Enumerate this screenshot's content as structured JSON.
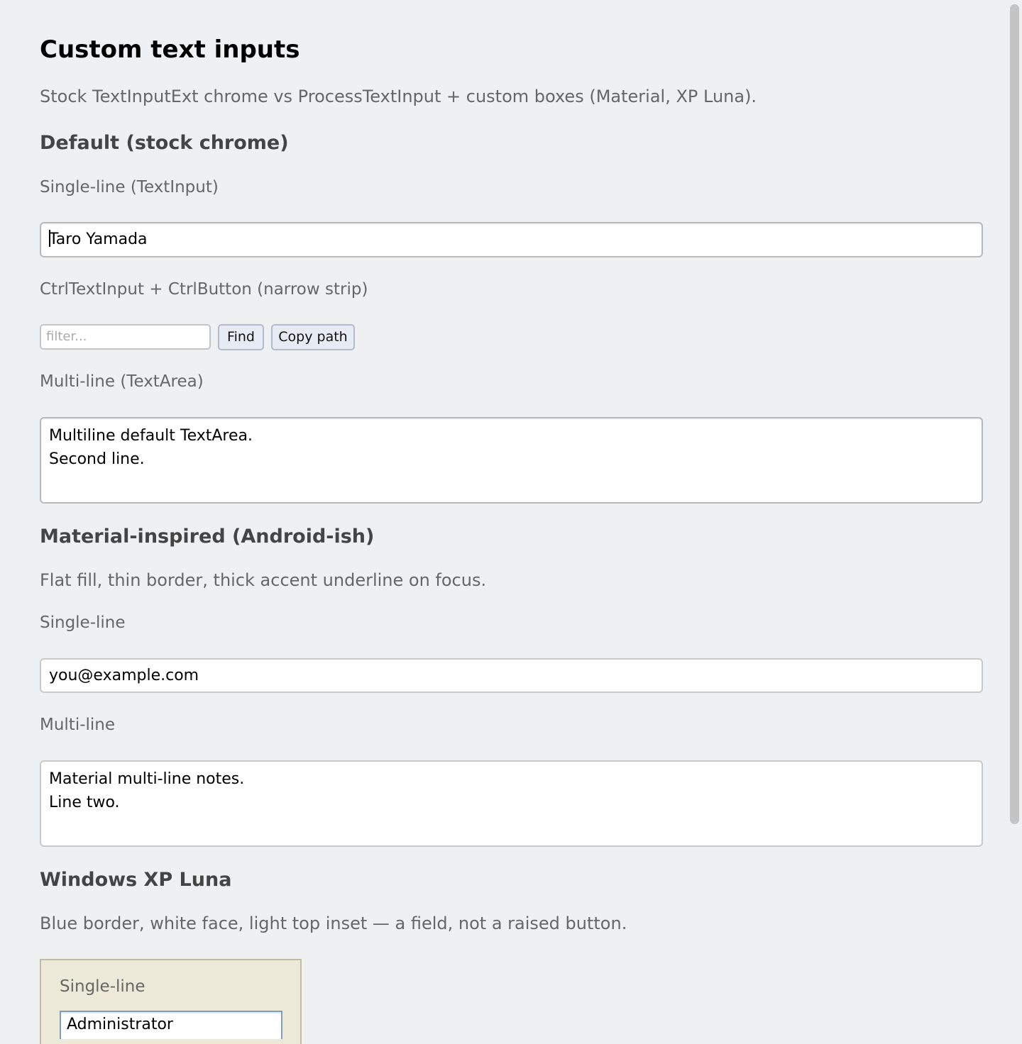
{
  "page": {
    "title": "Custom text inputs",
    "subtitle": "Stock TextInputExt chrome vs ProcessTextInput + custom boxes (Material, XP Luna)."
  },
  "default_section": {
    "heading": "Default (stock chrome)",
    "single_label": "Single-line (TextInput)",
    "single_value": "Taro Yamada",
    "strip_label": "CtrlTextInput + CtrlButton (narrow strip)",
    "filter_placeholder": "filter...",
    "find_button": "Find",
    "copy_button": "Copy path",
    "multi_label": "Multi-line (TextArea)",
    "multi_line1": "Multiline default TextArea.",
    "multi_line2": "Second line."
  },
  "material_section": {
    "heading": "Material-inspired (Android-ish)",
    "description": "Flat fill, thin border, thick accent underline on focus.",
    "single_label": "Single-line",
    "single_value": "you@example.com",
    "multi_label": "Multi-line",
    "multi_line1": "Material multi-line notes.",
    "multi_line2": "Line two."
  },
  "luna_section": {
    "heading": "Windows XP Luna",
    "description": "Blue border, white face, light top inset — a field, not a raised button.",
    "single_label": "Single-line",
    "single_value": "Administrator"
  },
  "colors": {
    "background": "#eff0f2",
    "luna_panel": "#ece9d8",
    "luna_border": "#7f9db9",
    "button_face": "#e7ebf4"
  }
}
